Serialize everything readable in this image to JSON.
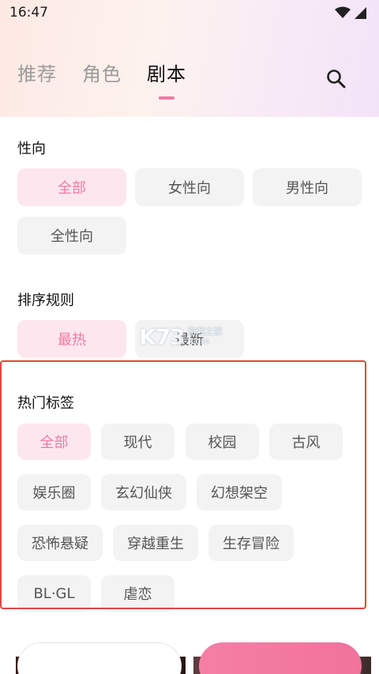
{
  "status_bar": {
    "time": "16:47",
    "icons": [
      "wifi-icon",
      "signal-icon"
    ]
  },
  "header": {
    "tabs": [
      {
        "label": "推荐",
        "active": false
      },
      {
        "label": "角色",
        "active": false
      },
      {
        "label": "剧本",
        "active": true
      }
    ],
    "search_icon": "search-icon",
    "accent_color": "#f07aa0"
  },
  "orientation": {
    "title": "性向",
    "options": [
      {
        "label": "全部",
        "selected": true
      },
      {
        "label": "女性向",
        "selected": false
      },
      {
        "label": "男性向",
        "selected": false
      },
      {
        "label": "全性向",
        "selected": false
      }
    ]
  },
  "sort": {
    "title": "排序规则",
    "options": [
      {
        "label": "最热",
        "selected": true
      },
      {
        "label": "最新",
        "selected": false
      }
    ]
  },
  "hot_tags": {
    "title": "热门标签",
    "tags": [
      {
        "label": "全部",
        "selected": true
      },
      {
        "label": "现代",
        "selected": false
      },
      {
        "label": "校园",
        "selected": false
      },
      {
        "label": "古风",
        "selected": false
      },
      {
        "label": "娱乐圈",
        "selected": false
      },
      {
        "label": "玄幻仙侠",
        "selected": false
      },
      {
        "label": "幻想架空",
        "selected": false
      },
      {
        "label": "恐怖悬疑",
        "selected": false
      },
      {
        "label": "穿越重生",
        "selected": false
      },
      {
        "label": "生存冒险",
        "selected": false
      },
      {
        "label": "BL·GL",
        "selected": false
      },
      {
        "label": "虐恋",
        "selected": false
      }
    ]
  },
  "watermark": {
    "logo": "K73",
    "line1": "游戏之家",
    "line2": ".com"
  },
  "colors": {
    "selected_bg": "#fde7ee",
    "selected_text": "#f07aa0",
    "chip_bg": "#f3f3f3",
    "highlight_border": "#e0473f"
  }
}
